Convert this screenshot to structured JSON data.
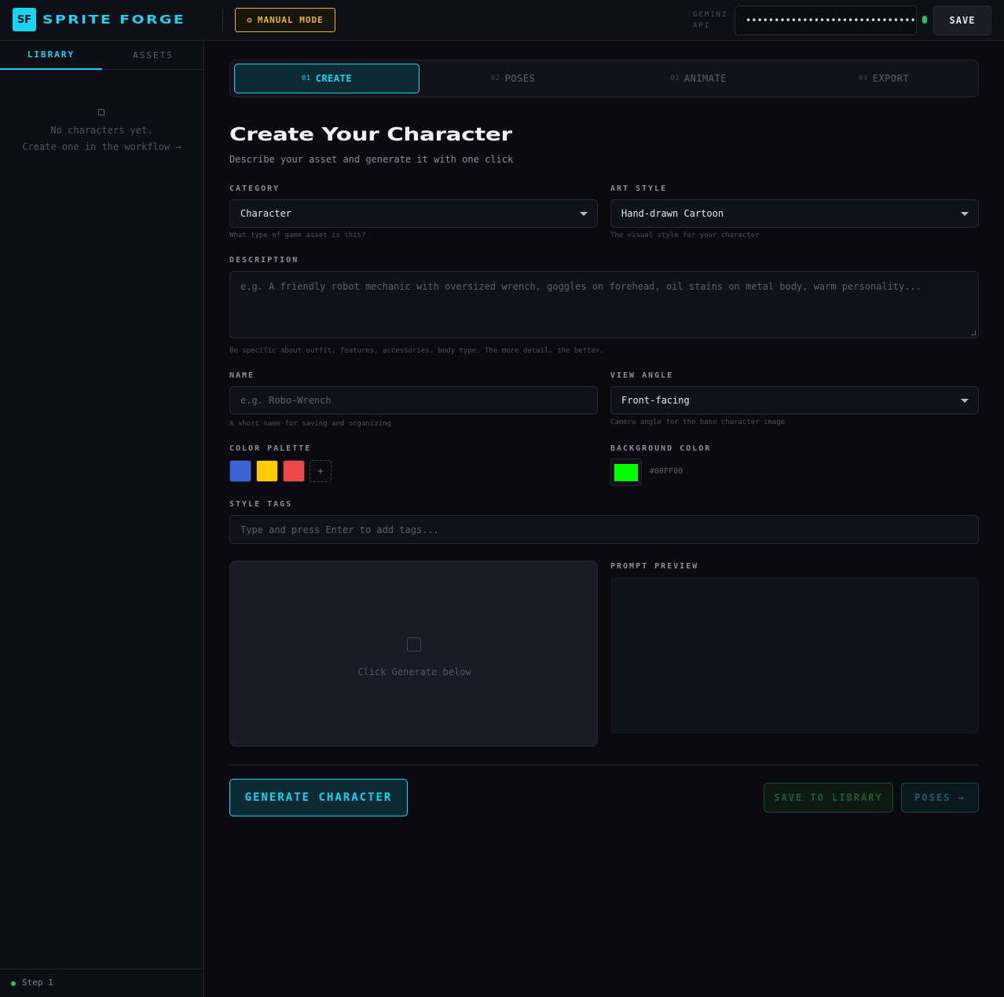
{
  "header": {
    "logo_text": "SF",
    "brand": "SPRITE FORGE",
    "mode_icon": "⚙",
    "mode_label": "MANUAL MODE",
    "api_label": "GEMINI API",
    "api_key_masked": "••••••••••••••••••••••••••••••••",
    "api_status_color": "#22c55e",
    "save_label": "SAVE"
  },
  "sidebar": {
    "tabs": [
      {
        "label": "LIBRARY",
        "active": true
      },
      {
        "label": "ASSETS",
        "active": false
      }
    ],
    "empty_line1": "No characters yet.",
    "empty_line2": "Create one in the workflow →",
    "footer_step": "Step 1"
  },
  "stepper": [
    {
      "num": "01",
      "label": "CREATE",
      "active": true
    },
    {
      "num": "02",
      "label": "POSES",
      "active": false
    },
    {
      "num": "03",
      "label": "ANIMATE",
      "active": false
    },
    {
      "num": "04",
      "label": "EXPORT",
      "active": false
    }
  ],
  "main": {
    "title": "Create Your Character",
    "subtitle": "Describe your asset and generate it with one click"
  },
  "form": {
    "category": {
      "label": "CATEGORY",
      "value": "Character",
      "hint": "What type of game asset is this?"
    },
    "art_style": {
      "label": "ART STYLE",
      "value": "Hand-drawn Cartoon",
      "hint": "The visual style for your character"
    },
    "description": {
      "label": "DESCRIPTION",
      "placeholder": "e.g. A friendly robot mechanic with oversized wrench, goggles on forehead, oil stains on metal body, warm personality...",
      "hint": "Be specific about outfit, features, accessories, body type. The more detail, the better."
    },
    "name": {
      "label": "NAME",
      "placeholder": "e.g. Robo-Wrench",
      "hint": "A short name for saving and organizing"
    },
    "view_angle": {
      "label": "VIEW ANGLE",
      "value": "Front-facing",
      "hint": "Camera angle for the base character image"
    },
    "palette": {
      "label": "COLOR PALETTE",
      "colors": [
        "#3a63d6",
        "#ffcc00",
        "#f0474a"
      ],
      "add_label": "+"
    },
    "background": {
      "label": "BACKGROUND COLOR",
      "color": "#00ff00",
      "hex": "#00FF00"
    },
    "style_tags": {
      "label": "STYLE TAGS",
      "placeholder": "Type and press Enter to add tags..."
    }
  },
  "preview": {
    "empty_text": "Click Generate below"
  },
  "prompt_preview": {
    "label": "PROMPT PREVIEW"
  },
  "actions": {
    "generate": "GENERATE CHARACTER",
    "save_library": "SAVE TO LIBRARY",
    "next": "POSES →"
  }
}
